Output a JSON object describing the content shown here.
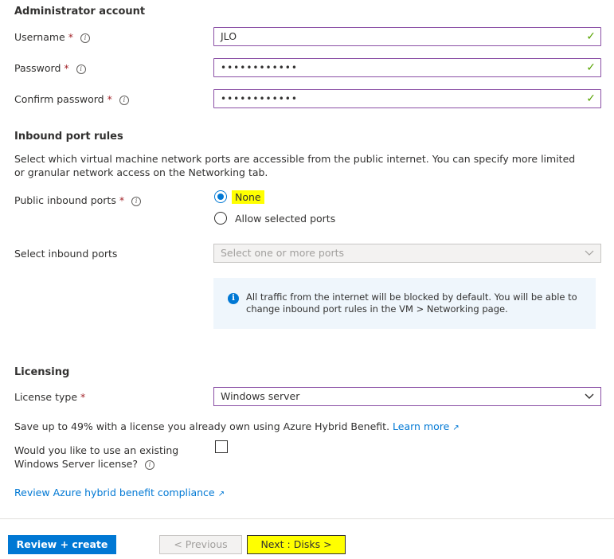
{
  "admin": {
    "title": "Administrator account",
    "username_label": "Username",
    "username_value": "JLO",
    "password_label": "Password",
    "password_value": "••••••••••••",
    "confirm_label": "Confirm password",
    "confirm_value": "••••••••••••"
  },
  "inbound": {
    "title": "Inbound port rules",
    "description": "Select which virtual machine network ports are accessible from the public internet. You can specify more limited or granular network access on the Networking tab.",
    "public_ports_label": "Public inbound ports",
    "option_none": "None",
    "option_allow": "Allow selected ports",
    "select_label": "Select inbound ports",
    "select_placeholder": "Select one or more ports",
    "info_text": "All traffic from the internet will be blocked by default. You will be able to change inbound port rules in the VM > Networking page."
  },
  "licensing": {
    "title": "Licensing",
    "license_type_label": "License type",
    "license_type_value": "Windows server",
    "save_text": "Save up to 49% with a license you already own using Azure Hybrid Benefit.",
    "learn_more": "Learn more",
    "existing_question": "Would you like to use an existing Windows Server license?",
    "review_link": "Review Azure hybrid benefit compliance"
  },
  "footer": {
    "review_create": "Review + create",
    "previous": "< Previous",
    "next": "Next : Disks >"
  },
  "colors": {
    "accent": "#0078d4",
    "valid_border": "#8a4fa5",
    "highlight": "#ffff00"
  }
}
